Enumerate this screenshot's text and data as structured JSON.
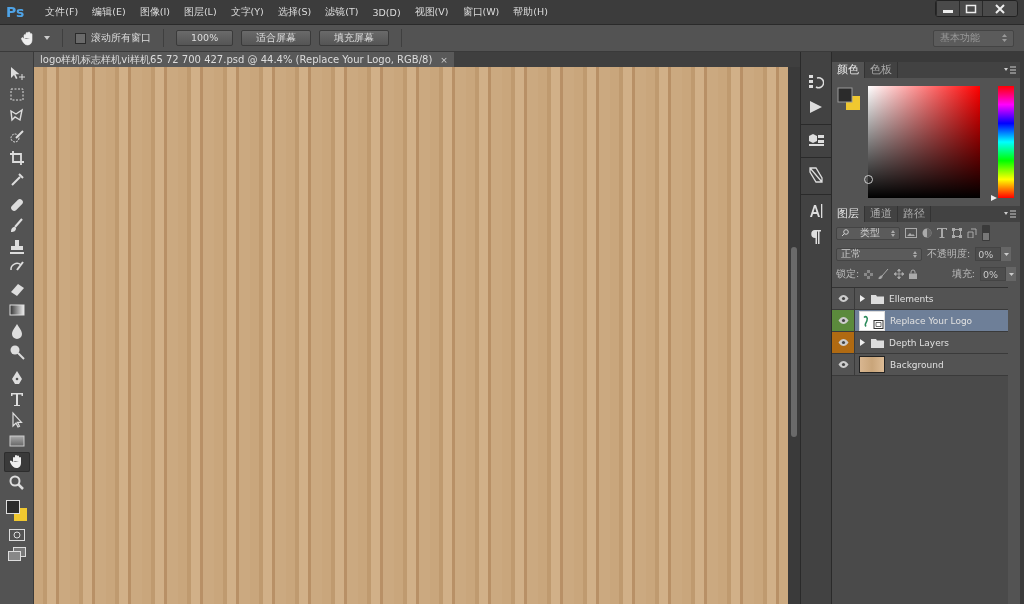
{
  "app": {
    "logo": "Ps"
  },
  "menu": [
    "文件(F)",
    "编辑(E)",
    "图像(I)",
    "图层(L)",
    "文字(Y)",
    "选择(S)",
    "滤镜(T)",
    "3D(D)",
    "视图(V)",
    "窗口(W)",
    "帮助(H)"
  ],
  "options_bar": {
    "scroll_all": {
      "label": "滚动所有窗口",
      "checked": false
    },
    "buttons": [
      "100%",
      "适合屏幕",
      "填充屏幕"
    ],
    "workspace": "基本功能"
  },
  "document_tab": {
    "title": "logo样机标志样机vi样机65 72 700 427.psd @ 44.4% (Replace Your Logo, RGB/8)",
    "close": "×"
  },
  "tools": [
    {
      "kind": "move",
      "selected": false
    },
    {
      "kind": "marquee",
      "selected": false
    },
    {
      "kind": "lasso",
      "selected": false
    },
    {
      "kind": "quick-select",
      "selected": false
    },
    {
      "kind": "crop",
      "selected": false
    },
    {
      "kind": "eyedropper",
      "selected": false
    },
    {
      "kind": "healing",
      "selected": false
    },
    {
      "kind": "brush",
      "selected": false
    },
    {
      "kind": "stamp",
      "selected": false
    },
    {
      "kind": "history-brush",
      "selected": false
    },
    {
      "kind": "eraser",
      "selected": false
    },
    {
      "kind": "gradient",
      "selected": false
    },
    {
      "kind": "blur",
      "selected": false
    },
    {
      "kind": "dodge",
      "selected": false
    },
    {
      "kind": "pen",
      "selected": false
    },
    {
      "kind": "type",
      "selected": false
    },
    {
      "kind": "path-select",
      "selected": false
    },
    {
      "kind": "shape",
      "selected": false
    },
    {
      "kind": "hand",
      "selected": true
    },
    {
      "kind": "zoom",
      "selected": false
    }
  ],
  "color_panel": {
    "tabs": [
      {
        "label": "颜色",
        "selected": true
      },
      {
        "label": "色板",
        "selected": false
      }
    ],
    "hue_slider": {
      "level": 0
    }
  },
  "layers_panel": {
    "tabs": [
      {
        "label": "图层",
        "selected": true
      },
      {
        "label": "通道",
        "selected": false
      },
      {
        "label": "路径",
        "selected": false
      }
    ],
    "filter": "类型",
    "blend_mode": "正常",
    "opacity_label": "不透明度:",
    "opacity": "0%",
    "lock_label": "锁定:",
    "fill_label": "填充:",
    "fill": "0%",
    "layers": [
      {
        "name": "Ellements",
        "kind": "group",
        "visible": true,
        "expanded": false,
        "selected": false
      },
      {
        "name": "Replace Your Logo",
        "kind": "smart",
        "visible": true,
        "selected": true,
        "color": "#5b8a3c"
      },
      {
        "name": "Depth Layers",
        "kind": "group",
        "visible": true,
        "expanded": false,
        "selected": false,
        "color": "#b06a12"
      },
      {
        "name": "Background",
        "kind": "image",
        "visible": true,
        "selected": false
      }
    ]
  }
}
